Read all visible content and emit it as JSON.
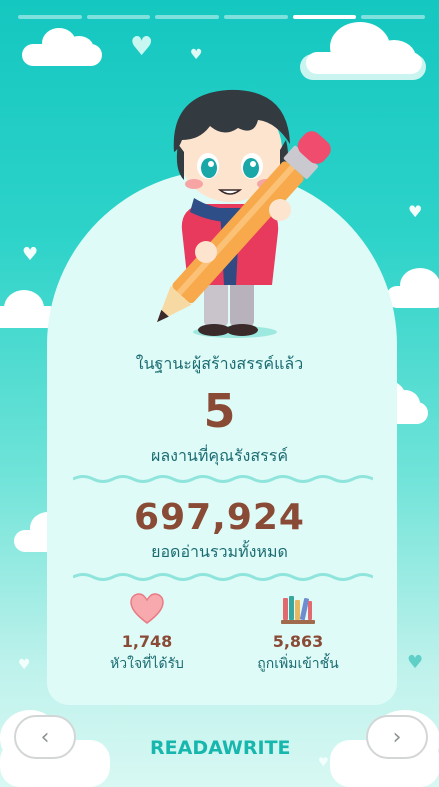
{
  "story": {
    "segments_total": 6,
    "active_segment": 5
  },
  "summary": {
    "role_text": "ในฐานะผู้สร้างสรรค์แล้ว",
    "works_count": "5",
    "works_label": "ผลงานที่คุณรังสรรค์",
    "total_reads": "697,924",
    "total_reads_label": "ยอดอ่านรวมทั้งหมด"
  },
  "stats": {
    "hearts_value": "1,748",
    "hearts_label": "หัวใจที่ได้รับ",
    "shelf_value": "5,863",
    "shelf_label": "ถูกเพิ่มเข้าชั้น"
  },
  "nav": {
    "prev_glyph": "‹",
    "next_glyph": "›"
  },
  "brand": {
    "logo_text": "READAWRITE"
  },
  "colors": {
    "accent_teal": "#18b7ad",
    "number_brown": "#8a4b36",
    "label_teal": "#1b6c72",
    "card_bg": "#dffbf7"
  },
  "icons": {
    "hearts": "heart-icon",
    "shelf": "bookshelf-icon",
    "prev": "chevron-left-icon",
    "next": "chevron-right-icon"
  }
}
